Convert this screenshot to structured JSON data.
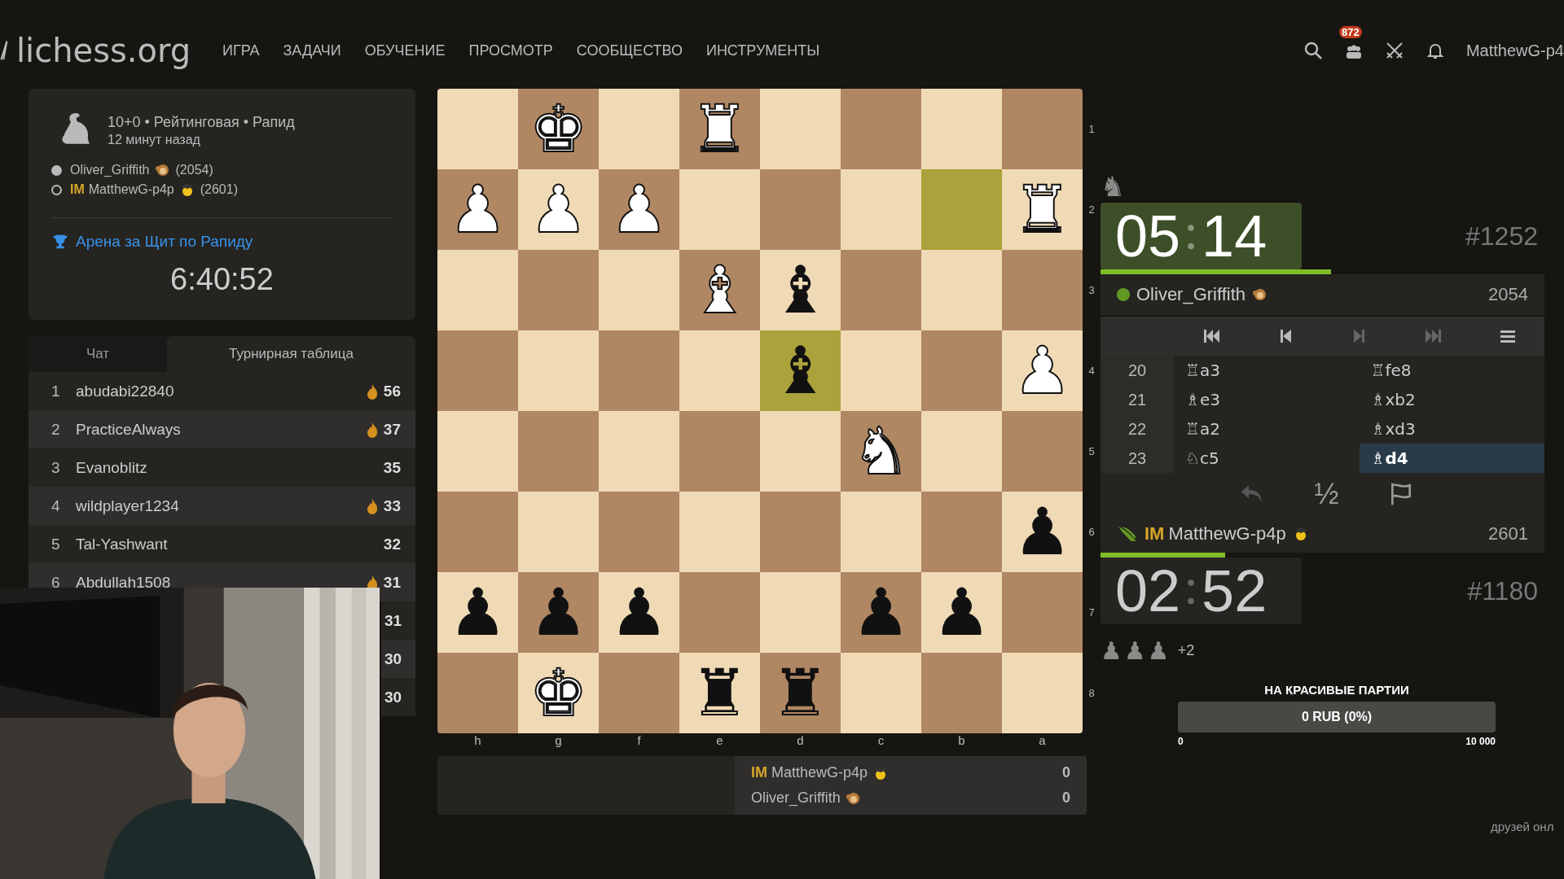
{
  "topbar": {
    "logo": "lichess.org",
    "nav": [
      "ИГРА",
      "ЗАДАЧИ",
      "ОБУЧЕНИЕ",
      "ПРОСМОТР",
      "СООБЩЕСТВО",
      "ИНСТРУМЕНТЫ"
    ],
    "badge": "872",
    "user": "MatthewG-p4"
  },
  "game_info": {
    "setup": "10+0 • Рейтинговая • Рапид",
    "time_ago": "12 минут назад",
    "players": [
      {
        "kind": "white",
        "name": "Oliver_Griffith",
        "flair": {
          "kind": "monkey"
        },
        "rating": "(2054)"
      },
      {
        "kind": "black",
        "title": "IM",
        "name": "MatthewG-p4p",
        "flair": {
          "kind": "student"
        },
        "rating": "(2601)"
      }
    ],
    "tournament": "Арена за Щит по Рапиду",
    "countdown": "6:40:52"
  },
  "side_tabs": [
    {
      "label": "Чат",
      "selected": false
    },
    {
      "label": "Турнирная таблица",
      "selected": true
    }
  ],
  "standings": [
    {
      "rank": "1",
      "name": "abudabi22840",
      "fire": true,
      "score": "56"
    },
    {
      "rank": "2",
      "name": "PracticeAlways",
      "fire": true,
      "score": "37"
    },
    {
      "rank": "3",
      "name": "Evanoblitz",
      "fire": false,
      "score": "35"
    },
    {
      "rank": "4",
      "name": "wildplayer1234",
      "fire": true,
      "score": "33"
    },
    {
      "rank": "5",
      "name": "Tal-Yashwant",
      "fire": false,
      "score": "32"
    },
    {
      "rank": "6",
      "name": "Abdullah1508",
      "fire": true,
      "score": "31"
    },
    {
      "score": "31"
    },
    {
      "score": "30"
    },
    {
      "score": "30"
    }
  ],
  "board": {
    "files": [
      "h",
      "g",
      "f",
      "e",
      "d",
      "c",
      "b",
      "a"
    ],
    "ranks": [
      {
        "label": "1",
        "cells": [
          {},
          {
            "piece": "♚",
            "kind": "white"
          },
          {},
          {
            "piece": "♜",
            "kind": "white"
          },
          {},
          {},
          {},
          {}
        ]
      },
      {
        "label": "2",
        "cells": [
          {
            "piece": "♟",
            "kind": "white"
          },
          {
            "piece": "♟",
            "kind": "white"
          },
          {
            "piece": "♟",
            "kind": "white"
          },
          {},
          {},
          {},
          {
            "highlighted": true
          },
          {
            "piece": "♜",
            "kind": "white"
          }
        ]
      },
      {
        "label": "3",
        "cells": [
          {},
          {},
          {},
          {
            "piece": "♝",
            "kind": "white"
          },
          {
            "piece": "♝",
            "kind": "black"
          },
          {},
          {},
          {}
        ]
      },
      {
        "label": "4",
        "cells": [
          {},
          {},
          {},
          {},
          {
            "piece": "♝",
            "kind": "black",
            "highlighted": true
          },
          {},
          {},
          {
            "piece": "♟",
            "kind": "white"
          }
        ]
      },
      {
        "label": "5",
        "cells": [
          {},
          {},
          {},
          {},
          {},
          {
            "piece": "♞",
            "kind": "white"
          },
          {},
          {}
        ]
      },
      {
        "label": "6",
        "cells": [
          {},
          {},
          {},
          {},
          {},
          {},
          {},
          {
            "piece": "♟",
            "kind": "black"
          }
        ]
      },
      {
        "label": "7",
        "cells": [
          {
            "piece": "♟",
            "kind": "black"
          },
          {
            "piece": "♟",
            "kind": "black"
          },
          {
            "piece": "♟",
            "kind": "black"
          },
          {},
          {},
          {
            "piece": "♟",
            "kind": "black"
          },
          {
            "piece": "♟",
            "kind": "black"
          },
          {}
        ]
      },
      {
        "label": "8",
        "cells": [
          {},
          {
            "piece": "♚",
            "kind": "white"
          },
          {},
          {
            "piece": "♜",
            "kind": "black"
          },
          {
            "piece": "♜",
            "kind": "black"
          },
          {},
          {},
          {}
        ]
      }
    ]
  },
  "match_score": [
    {
      "title": "IM",
      "name": "MatthewG-p4p",
      "flair": {
        "kind": "student"
      },
      "score": "0"
    },
    {
      "name": "Oliver_Griffith",
      "flair": {
        "kind": "monkey"
      },
      "score": "0"
    }
  ],
  "top_material": [
    "♞"
  ],
  "top_clock": {
    "minutes": "05",
    "seconds": "14",
    "active": true,
    "level": 0.52,
    "place": "#1252"
  },
  "top_player": {
    "kind": "online",
    "name": "Oliver_Griffith",
    "flair": {
      "kind": "monkey"
    },
    "rating": "2054"
  },
  "nav_buttons": [
    {
      "kind": "first",
      "disabled": false
    },
    {
      "kind": "prev",
      "disabled": false
    },
    {
      "kind": "next",
      "disabled": true
    },
    {
      "kind": "last",
      "disabled": true
    },
    {
      "kind": "menu",
      "disabled": false
    }
  ],
  "moves": [
    {
      "no": "20",
      "white": {
        "san": "♖a3",
        "selected": false
      },
      "black": {
        "san": "♖fe8",
        "selected": false
      }
    },
    {
      "no": "21",
      "white": {
        "san": "♗e3",
        "selected": false
      },
      "black": {
        "san": "♗xb2",
        "selected": false
      }
    },
    {
      "no": "22",
      "white": {
        "san": "♖a2",
        "selected": false
      },
      "black": {
        "san": "♗xd3",
        "selected": false
      }
    },
    {
      "no": "23",
      "white": {
        "san": "♘c5",
        "selected": false
      },
      "black": {
        "san": "♗d4",
        "selected": true
      }
    }
  ],
  "actions": [
    {
      "kind": "takeback"
    },
    {
      "kind": "draw",
      "label": "½"
    },
    {
      "kind": "resign"
    }
  ],
  "bottom_player": {
    "kind": "berserk",
    "title": "IM",
    "name": "MatthewG-p4p",
    "flair": {
      "kind": "student"
    },
    "rating": "2601"
  },
  "bottom_clock": {
    "minutes": "02",
    "seconds": "52",
    "active": false,
    "level": 0.28,
    "place": "#1180"
  },
  "bottom_material": {
    "pieces": [
      "♟",
      "♟",
      "♟"
    ],
    "diff": "+2"
  },
  "donation": {
    "title": "НА КРАСИВЫЕ ПАРТИИ",
    "amount": "0 RUB (0%)",
    "level": 0,
    "min": "0",
    "max": "10 000"
  },
  "cut_text": "друзей онл",
  "webcam": {
    "kind": "picture"
  }
}
